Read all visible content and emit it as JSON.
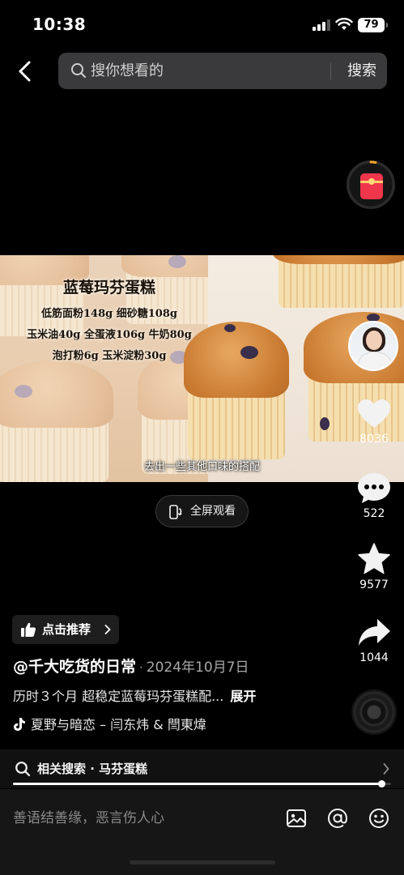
{
  "status_bar": {
    "time": "10:38",
    "battery": "79"
  },
  "search": {
    "placeholder": "搜你想看的",
    "button_label": "搜索"
  },
  "video": {
    "recipe_title": "蓝莓玛芬蛋糕",
    "recipe_lines": [
      "低筋面粉148g 细砂糖108g",
      "玉米油40g 全蛋液106g 牛奶80g",
      "泡打粉6g 玉米淀粉30g"
    ],
    "subtitle": "去出一些其他口味的搭配"
  },
  "fullscreen": {
    "label": "全屏观看"
  },
  "actions": {
    "like_count": "8036",
    "comment_count": "522",
    "favorite_count": "9577",
    "share_count": "1044"
  },
  "recommend": {
    "label": "点击推荐"
  },
  "post": {
    "author": "@千大吃货的日常",
    "separator": "·",
    "date": "2024年10月7日",
    "description": "历时３个月 超稳定蓝莓玛芬蛋糕配...",
    "expand_label": "展开",
    "music": "夏野与暗恋 – 闫东炜 & 閆東煒"
  },
  "related": {
    "label": "相关搜索 · 马芬蛋糕"
  },
  "progress": {
    "fraction": 0.975
  },
  "comment_bar": {
    "placeholder": "善语结善缘，恶言伤人心"
  },
  "icons": {
    "back": "chevron-left-icon",
    "search": "search-icon",
    "redpacket": "red-envelope-icon",
    "like": "heart-icon",
    "comment": "comment-bubble-icon",
    "favorite": "star-icon",
    "share": "share-arrow-icon",
    "fullscreen": "rotate-phone-icon",
    "recommend": "thumbs-up-icon",
    "music": "tiktok-note-icon",
    "image": "image-icon",
    "mention": "at-icon",
    "emoji": "emoji-icon"
  },
  "colors": {
    "background": "#000000",
    "redpacket": "#f0364b",
    "search_bg": "#3a3a3c",
    "comment_bar_bg": "#161616"
  }
}
